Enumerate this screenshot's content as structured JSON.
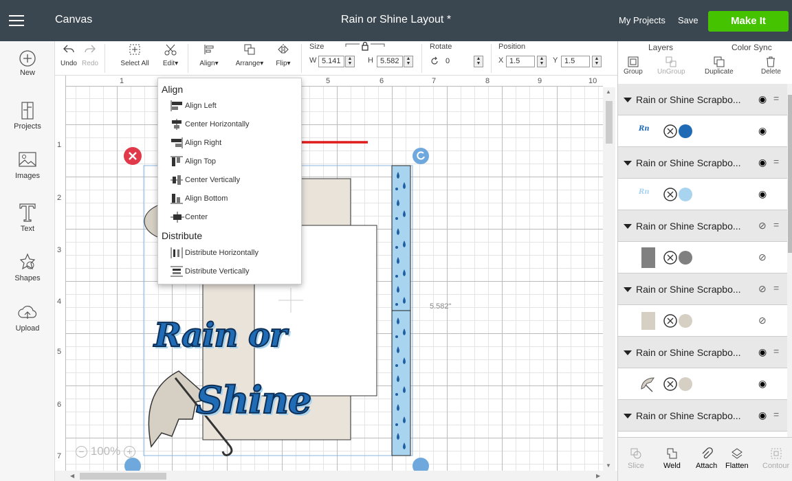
{
  "header": {
    "app_name": "Canvas",
    "project_title": "Rain or Shine Layout *",
    "my_projects": "My Projects",
    "save": "Save",
    "make_it": "Make It",
    "accent_color": "#45c300"
  },
  "sidebar": {
    "items": [
      {
        "label": "New",
        "icon": "plus-circle-icon"
      },
      {
        "label": "Projects",
        "icon": "projects-icon"
      },
      {
        "label": "Images",
        "icon": "images-icon"
      },
      {
        "label": "Text",
        "icon": "text-icon"
      },
      {
        "label": "Shapes",
        "icon": "shapes-icon"
      },
      {
        "label": "Upload",
        "icon": "upload-icon"
      }
    ]
  },
  "toolbar": {
    "undo": "Undo",
    "redo": "Redo",
    "select_all": "Select All",
    "edit": "Edit",
    "align": "Align",
    "arrange": "Arrange",
    "flip": "Flip",
    "size_label": "Size",
    "w_label": "W",
    "w_value": "5.141",
    "h_label": "H",
    "h_value": "5.582",
    "rotate_label": "Rotate",
    "rotate_value": "0",
    "position_label": "Position",
    "x_label": "X",
    "x_value": "1.5",
    "y_label": "Y",
    "y_value": "1.5"
  },
  "align_menu": {
    "align_heading": "Align",
    "align_items": [
      "Align Left",
      "Center Horizontally",
      "Align Right",
      "Align Top",
      "Center Vertically",
      "Align Bottom",
      "Center"
    ],
    "distribute_heading": "Distribute",
    "distribute_items": [
      "Distribute Horizontally",
      "Distribute Vertically"
    ]
  },
  "canvas": {
    "ruler_top": [
      "1",
      "5",
      "6",
      "7",
      "8",
      "9",
      "10"
    ],
    "ruler_left": [
      "1",
      "2",
      "3",
      "4",
      "5",
      "6",
      "7"
    ],
    "height_dimension": "5.582\"",
    "zoom": "100%",
    "artwork_text_line1": "Rain or",
    "artwork_text_line2": "Shine"
  },
  "layers_panel": {
    "tabs": [
      "Layers",
      "Color Sync"
    ],
    "tools": [
      "Group",
      "UnGroup",
      "Duplicate",
      "Delete"
    ],
    "group_name": "Rain or Shine Scrapbo...",
    "bottom_tools": [
      "Slice",
      "Weld",
      "Attach",
      "Flatten",
      "Contour"
    ],
    "colors": {
      "blue": "#1f6bb5",
      "light_blue": "#a8d4f0",
      "gray": "#808080",
      "beige": "#d6d0c4"
    }
  }
}
